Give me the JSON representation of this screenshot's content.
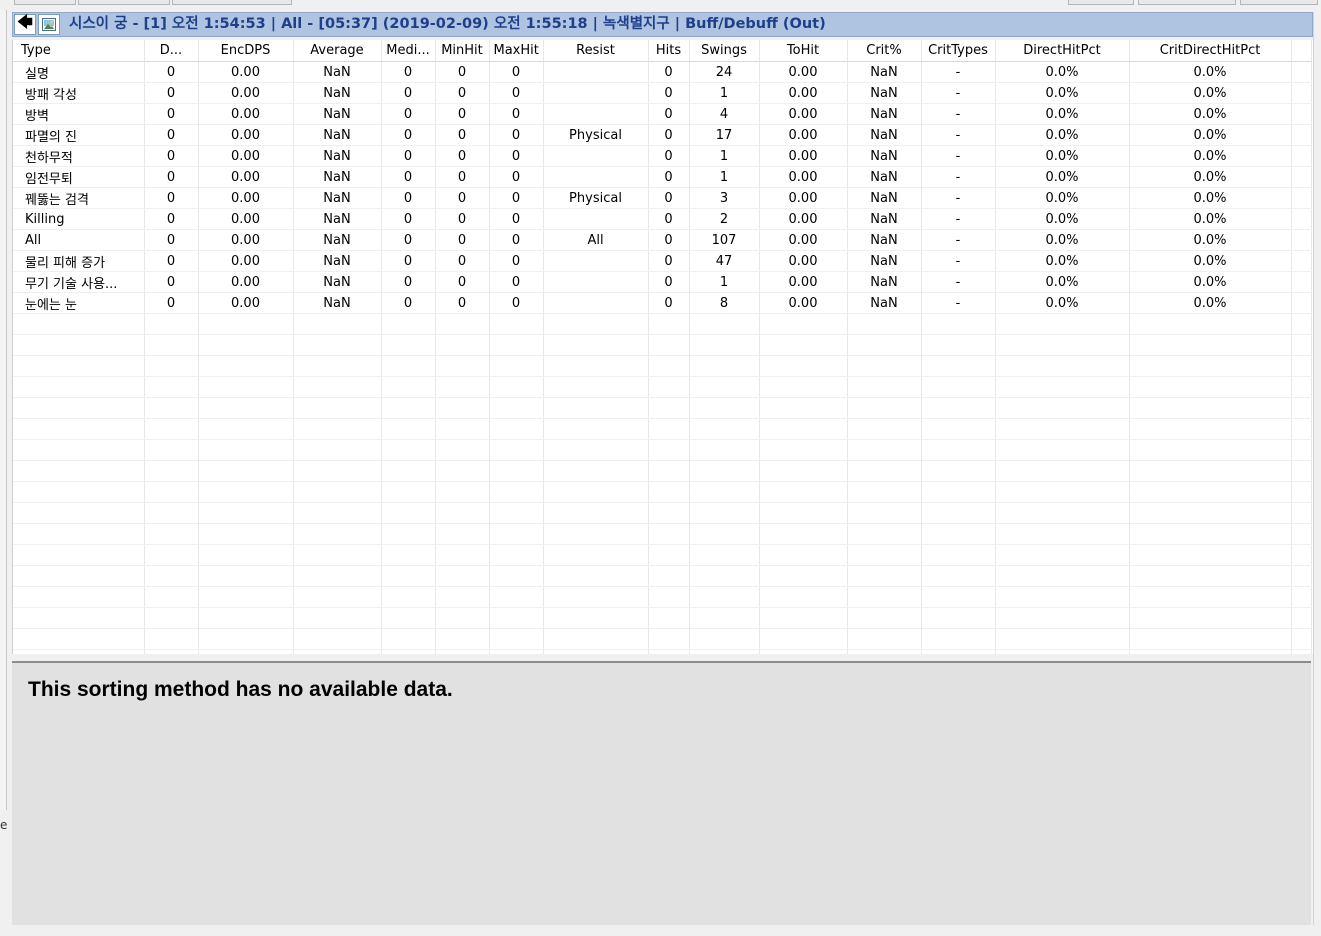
{
  "header": {
    "back_glyph": "🡄",
    "image_glyph": "🖼",
    "title": "시스이 궁 - [1] 오전 1:54:53 | All - [05:37] (2019-02-09) 오전 1:55:18 | 녹색별지구 | Buff/Debuff (Out)"
  },
  "left_glyph": "e",
  "sort_indicator": "^",
  "table": {
    "columns": [
      "Type",
      "D...",
      "EncDPS",
      "Average",
      "Medi...",
      "MinHit",
      "MaxHit",
      "Resist",
      "Hits",
      "Swings",
      "ToHit",
      "Crit%",
      "CritTypes",
      "DirectHitPct",
      "CritDirectHitPct"
    ],
    "rows": [
      [
        "실명",
        "0",
        "0.00",
        "NaN",
        "0",
        "0",
        "0",
        "",
        "0",
        "24",
        "0.00",
        "NaN",
        "-",
        "0.0%",
        "0.0%"
      ],
      [
        "방패 각성",
        "0",
        "0.00",
        "NaN",
        "0",
        "0",
        "0",
        "",
        "0",
        "1",
        "0.00",
        "NaN",
        "-",
        "0.0%",
        "0.0%"
      ],
      [
        "방벽",
        "0",
        "0.00",
        "NaN",
        "0",
        "0",
        "0",
        "",
        "0",
        "4",
        "0.00",
        "NaN",
        "-",
        "0.0%",
        "0.0%"
      ],
      [
        "파멸의 진",
        "0",
        "0.00",
        "NaN",
        "0",
        "0",
        "0",
        "Physical",
        "0",
        "17",
        "0.00",
        "NaN",
        "-",
        "0.0%",
        "0.0%"
      ],
      [
        "천하무적",
        "0",
        "0.00",
        "NaN",
        "0",
        "0",
        "0",
        "",
        "0",
        "1",
        "0.00",
        "NaN",
        "-",
        "0.0%",
        "0.0%"
      ],
      [
        "임전무퇴",
        "0",
        "0.00",
        "NaN",
        "0",
        "0",
        "0",
        "",
        "0",
        "1",
        "0.00",
        "NaN",
        "-",
        "0.0%",
        "0.0%"
      ],
      [
        "꿰뚫는 검격",
        "0",
        "0.00",
        "NaN",
        "0",
        "0",
        "0",
        "Physical",
        "0",
        "3",
        "0.00",
        "NaN",
        "-",
        "0.0%",
        "0.0%"
      ],
      [
        "Killing",
        "0",
        "0.00",
        "NaN",
        "0",
        "0",
        "0",
        "",
        "0",
        "2",
        "0.00",
        "NaN",
        "-",
        "0.0%",
        "0.0%"
      ],
      [
        "All",
        "0",
        "0.00",
        "NaN",
        "0",
        "0",
        "0",
        "All",
        "0",
        "107",
        "0.00",
        "NaN",
        "-",
        "0.0%",
        "0.0%"
      ],
      [
        "물리 피해 증가",
        "0",
        "0.00",
        "NaN",
        "0",
        "0",
        "0",
        "",
        "0",
        "47",
        "0.00",
        "NaN",
        "-",
        "0.0%",
        "0.0%"
      ],
      [
        "무기 기술 사용...",
        "0",
        "0.00",
        "NaN",
        "0",
        "0",
        "0",
        "",
        "0",
        "1",
        "0.00",
        "NaN",
        "-",
        "0.0%",
        "0.0%"
      ],
      [
        "눈에는 눈",
        "0",
        "0.00",
        "NaN",
        "0",
        "0",
        "0",
        "",
        "0",
        "8",
        "0.00",
        "NaN",
        "-",
        "0.0%",
        "0.0%"
      ]
    ]
  },
  "message": "This sorting method has no available data."
}
